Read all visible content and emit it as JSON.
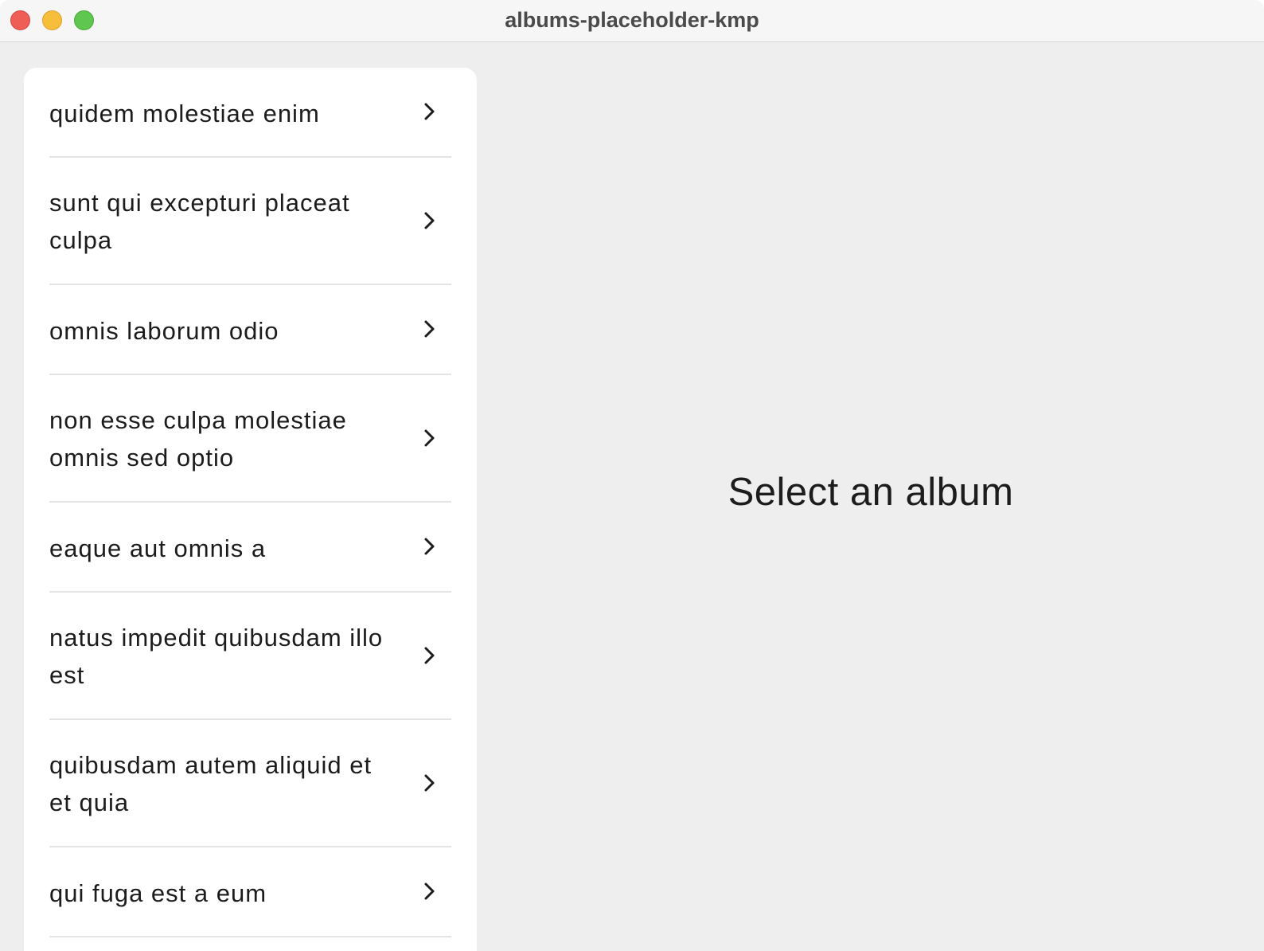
{
  "window": {
    "title": "albums-placeholder-kmp"
  },
  "albums": {
    "items": [
      {
        "label": "quidem molestiae enim"
      },
      {
        "label": "sunt qui excepturi placeat culpa"
      },
      {
        "label": "omnis laborum odio"
      },
      {
        "label": "non esse culpa molestiae omnis sed optio"
      },
      {
        "label": "eaque aut omnis a"
      },
      {
        "label": "natus impedit quibusdam illo est"
      },
      {
        "label": "quibusdam autem aliquid et et quia"
      },
      {
        "label": "qui fuga est a eum"
      }
    ],
    "item_icon": "chevron-right-icon"
  },
  "detail": {
    "placeholder": "Select an album"
  },
  "colors": {
    "background": "#eeeeee",
    "panel": "#ffffff",
    "text": "#1c1c1c",
    "divider": "#e4e4e4"
  }
}
